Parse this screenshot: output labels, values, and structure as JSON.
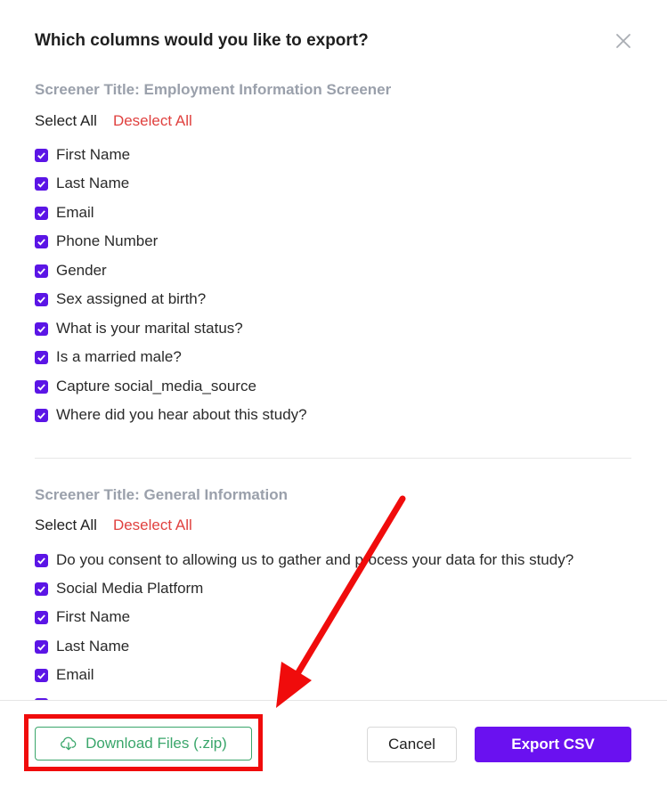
{
  "modal": {
    "title": "Which columns would you like to export?",
    "close_icon": "close-icon"
  },
  "sections": [
    {
      "title": "Screener Title: Employment Information Screener",
      "select_all": "Select All",
      "deselect_all": "Deselect All",
      "items": [
        "First Name",
        "Last Name",
        "Email",
        "Phone Number",
        "Gender",
        "Sex assigned at birth?",
        "What is your marital status?",
        "Is a married male?",
        "Capture social_media_source",
        "Where did you hear about this study?"
      ]
    },
    {
      "title": "Screener Title: General Information",
      "select_all": "Select All",
      "deselect_all": "Deselect All",
      "items": [
        "Do you consent to allowing us to gather and process your data for this study?",
        "Social Media Platform",
        "First Name",
        "Last Name",
        "Email"
      ]
    }
  ],
  "footer": {
    "download_label": "Download Files (.zip)",
    "download_icon": "cloud-download-icon",
    "cancel_label": "Cancel",
    "export_label": "Export CSV"
  },
  "colors": {
    "checkbox": "#5b15e6",
    "deselect": "#e0413f",
    "download": "#3aa66b",
    "export": "#6a11f0",
    "annotation": "#f00c0c"
  }
}
